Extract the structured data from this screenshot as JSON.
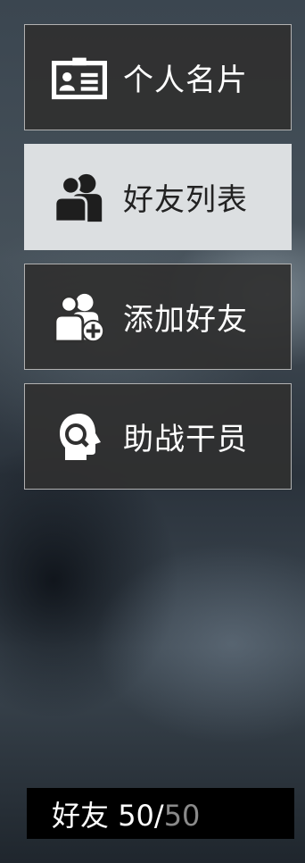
{
  "menu": {
    "items": [
      {
        "label": "个人名片",
        "icon": "id-card-icon",
        "active": false
      },
      {
        "label": "好友列表",
        "icon": "friends-icon",
        "active": true
      },
      {
        "label": "添加好友",
        "icon": "add-friend-icon",
        "active": false
      },
      {
        "label": "助战干员",
        "icon": "support-operator-icon",
        "active": false
      }
    ]
  },
  "footer": {
    "label": "好友",
    "count": "50",
    "separator": "/",
    "max": "50"
  },
  "colors": {
    "item_bg": "#303030",
    "item_active_bg": "#dcdfe1",
    "footer_bg": "#000000",
    "max_text": "#8a8a8a"
  }
}
